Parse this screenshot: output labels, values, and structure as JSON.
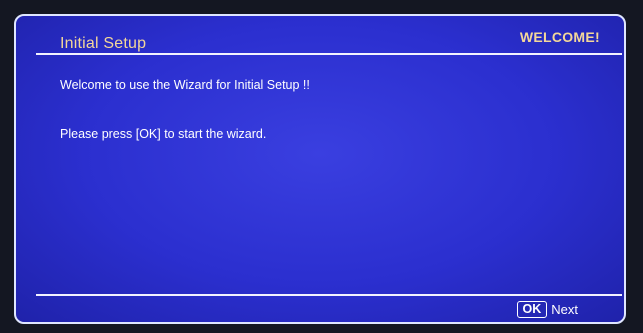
{
  "dialog": {
    "title": "Initial Setup",
    "badge": "WELCOME!",
    "message_line1": "Welcome to use the Wizard for Initial Setup !!",
    "message_line2": "Please press [OK] to start the wizard."
  },
  "footer": {
    "ok_key_label": "OK",
    "next_label": "Next"
  },
  "colors": {
    "dialog_background": "#2b2fcf",
    "title_text": "#f3d79a",
    "body_text": "#ffffff",
    "border": "#dfe6ff"
  }
}
